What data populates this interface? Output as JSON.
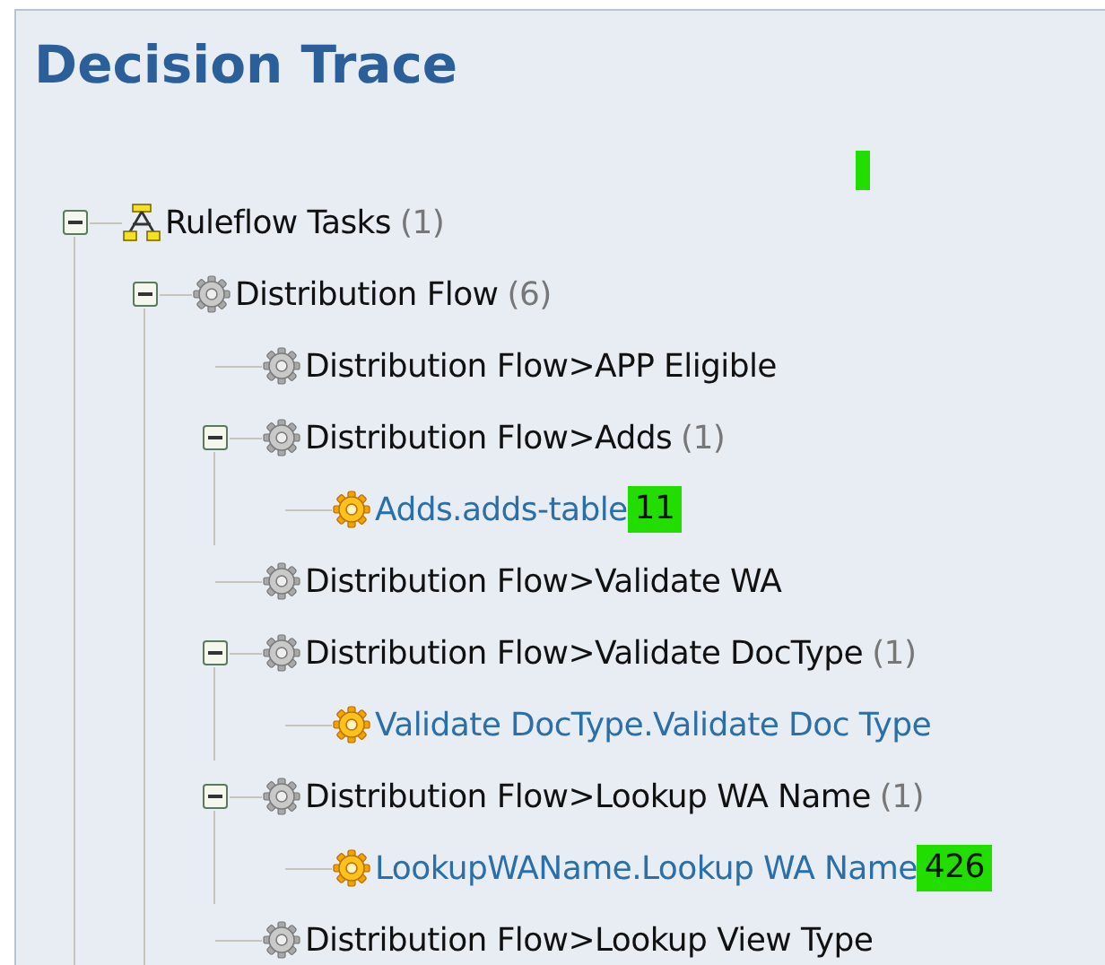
{
  "title": "Decision Trace",
  "tree": [
    {
      "kind": "task",
      "label": "Ruleflow Tasks",
      "count": "(1)",
      "expanded": true,
      "children": [
        {
          "kind": "flow",
          "label": "Distribution Flow",
          "count": "(6)",
          "expanded": true,
          "children": [
            {
              "kind": "flow",
              "label": "Distribution Flow>APP Eligible"
            },
            {
              "kind": "flow",
              "label": "Distribution Flow>Adds",
              "count": "(1)",
              "expanded": true,
              "children": [
                {
                  "kind": "rule",
                  "label": "Adds.adds-table",
                  "badge": "11"
                }
              ]
            },
            {
              "kind": "flow",
              "label": "Distribution Flow>Validate WA"
            },
            {
              "kind": "flow",
              "label": "Distribution Flow>Validate DocType",
              "count": "(1)",
              "expanded": true,
              "children": [
                {
                  "kind": "rule",
                  "label": "Validate DocType.Validate Doc Type"
                }
              ]
            },
            {
              "kind": "flow",
              "label": "Distribution Flow>Lookup WA Name",
              "count": "(1)",
              "expanded": true,
              "children": [
                {
                  "kind": "rule",
                  "label": "LookupWAName.Lookup WA Name",
                  "badge": "426"
                }
              ]
            },
            {
              "kind": "flow",
              "label": "Distribution Flow>Lookup View Type"
            }
          ]
        }
      ]
    }
  ]
}
